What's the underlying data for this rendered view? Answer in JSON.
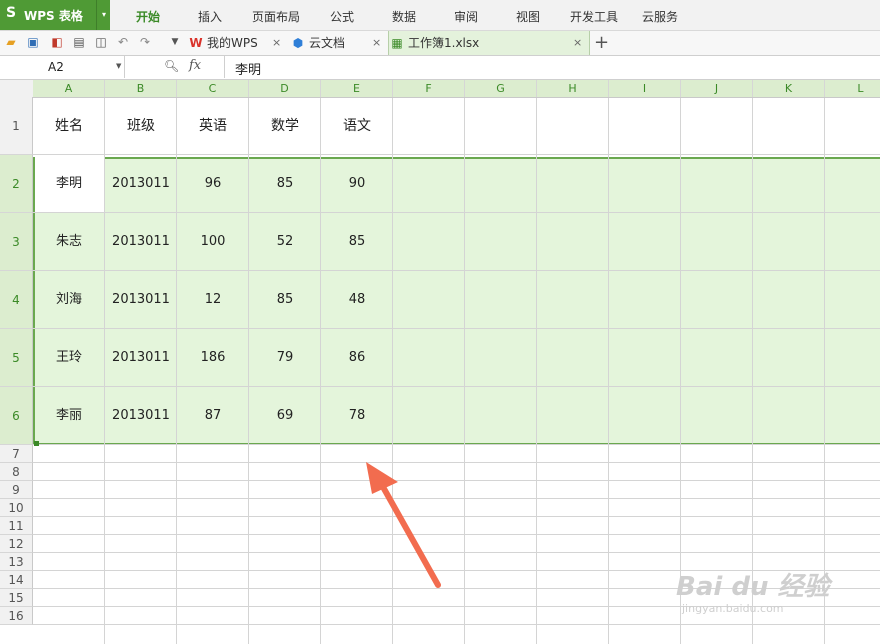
{
  "app": {
    "name": "WPS 表格",
    "logo": "S",
    "dropdown": "▾"
  },
  "menu": [
    {
      "label": "开始",
      "active": true
    },
    {
      "label": "插入"
    },
    {
      "label": "页面布局"
    },
    {
      "label": "公式"
    },
    {
      "label": "数据"
    },
    {
      "label": "审阅"
    },
    {
      "label": "视图"
    },
    {
      "label": "开发工具"
    },
    {
      "label": "云服务"
    }
  ],
  "quick_icons": [
    "open-folder-icon",
    "save-icon",
    "export-pdf-icon",
    "print-icon",
    "print-preview-icon",
    "undo-icon",
    "redo-icon",
    "more-dropdown-icon"
  ],
  "tabs": [
    {
      "label": "我的WPS",
      "icon": "wps-logo-icon",
      "close": "×"
    },
    {
      "label": "云文档",
      "icon": "cloud-doc-icon",
      "close": "×"
    },
    {
      "label": "工作簿1.xlsx",
      "icon": "workbook-icon",
      "close": "×",
      "active": true
    }
  ],
  "new_tab": "+",
  "formula_bar": {
    "cell_ref": "A2",
    "fx": "fx",
    "value": "李明"
  },
  "columns": [
    "A",
    "B",
    "C",
    "D",
    "E",
    "F",
    "G",
    "H",
    "I",
    "J",
    "K",
    "L"
  ],
  "rows": [
    "1",
    "2",
    "3",
    "4",
    "5",
    "6",
    "7",
    "8",
    "9",
    "10",
    "11",
    "12",
    "13",
    "14",
    "15",
    "16"
  ],
  "table": [
    [
      "姓名",
      "班级",
      "英语",
      "数学",
      "语文"
    ],
    [
      "李明",
      "2013011",
      "96",
      "85",
      "90"
    ],
    [
      "朱志",
      "2013011",
      "100",
      "52",
      "85"
    ],
    [
      "刘海",
      "2013011",
      "12",
      "85",
      "48"
    ],
    [
      "王玲",
      "2013011",
      "186",
      "79",
      "86"
    ],
    [
      "李丽",
      "2013011",
      "87",
      "69",
      "78"
    ]
  ],
  "colors": {
    "accent": "#4f9a35",
    "selection": "#e4f5db",
    "arrow": "#f26c4f"
  },
  "watermark": {
    "main": "Bai du 经验",
    "sub": "jingyan.baidu.com"
  }
}
